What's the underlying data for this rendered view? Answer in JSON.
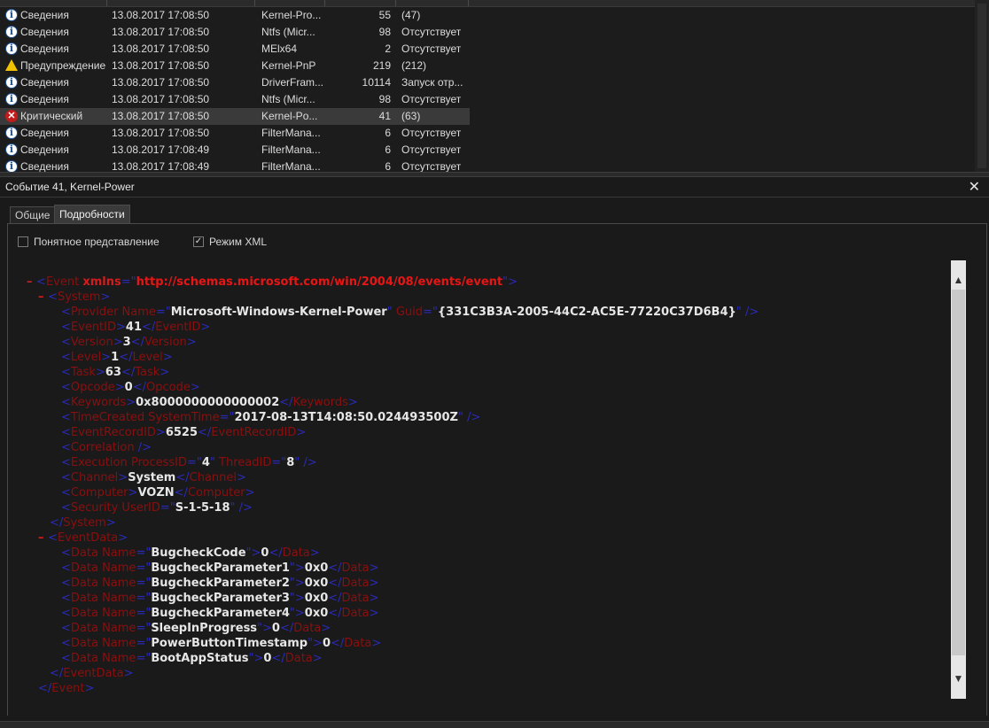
{
  "events": [
    {
      "level": "Сведения",
      "type": "info",
      "date": "13.08.2017 17:08:50",
      "source": "Kernel-Pro...",
      "id": "55",
      "task": "(47)"
    },
    {
      "level": "Сведения",
      "type": "info",
      "date": "13.08.2017 17:08:50",
      "source": "Ntfs (Micr...",
      "id": "98",
      "task": "Отсутствует"
    },
    {
      "level": "Сведения",
      "type": "info",
      "date": "13.08.2017 17:08:50",
      "source": "MElx64",
      "id": "2",
      "task": "Отсутствует"
    },
    {
      "level": "Предупреждение",
      "type": "warning",
      "date": "13.08.2017 17:08:50",
      "source": "Kernel-PnP",
      "id": "219",
      "task": "(212)"
    },
    {
      "level": "Сведения",
      "type": "info",
      "date": "13.08.2017 17:08:50",
      "source": "DriverFram...",
      "id": "10114",
      "task": "Запуск отр..."
    },
    {
      "level": "Сведения",
      "type": "info",
      "date": "13.08.2017 17:08:50",
      "source": "Ntfs (Micr...",
      "id": "98",
      "task": "Отсутствует"
    },
    {
      "level": "Критический",
      "type": "critical",
      "date": "13.08.2017 17:08:50",
      "source": "Kernel-Po...",
      "id": "41",
      "task": "(63)",
      "selected": true
    },
    {
      "level": "Сведения",
      "type": "info",
      "date": "13.08.2017 17:08:50",
      "source": "FilterMana...",
      "id": "6",
      "task": "Отсутствует"
    },
    {
      "level": "Сведения",
      "type": "info",
      "date": "13.08.2017 17:08:49",
      "source": "FilterMana...",
      "id": "6",
      "task": "Отсутствует"
    },
    {
      "level": "Сведения",
      "type": "info",
      "date": "13.08.2017 17:08:49",
      "source": "FilterMana...",
      "id": "6",
      "task": "Отсутствует"
    }
  ],
  "detail": {
    "title": "Событие 41, Kernel-Power",
    "close": "✕",
    "tabs": [
      "Общие",
      "Подробности"
    ],
    "active_tab": 1,
    "view_friendly": "Понятное представление",
    "view_xml": "Режим XML",
    "xml_checked": true
  },
  "xml": {
    "namespace": "http://schemas.microsoft.com/win/2004/08/events/event",
    "provider_name": "Microsoft-Windows-Kernel-Power",
    "provider_guid": "{331C3B3A-2005-44C2-AC5E-77220C37D6B4}",
    "event_id": "41",
    "version": "3",
    "level": "1",
    "task": "63",
    "opcode": "0",
    "keywords": "0x8000000000000002",
    "time_created": "2017-08-13T14:08:50.024493500Z",
    "event_record_id": "6525",
    "process_id": "4",
    "thread_id": "8",
    "channel": "System",
    "computer": "VOZN",
    "user_id": "S-1-5-18",
    "data": [
      {
        "name": "BugcheckCode",
        "value": "0"
      },
      {
        "name": "BugcheckParameter1",
        "value": "0x0"
      },
      {
        "name": "BugcheckParameter2",
        "value": "0x0"
      },
      {
        "name": "BugcheckParameter3",
        "value": "0x0"
      },
      {
        "name": "BugcheckParameter4",
        "value": "0x0"
      },
      {
        "name": "SleepInProgress",
        "value": "0"
      },
      {
        "name": "PowerButtonTimestamp",
        "value": "0"
      },
      {
        "name": "BootAppStatus",
        "value": "0"
      }
    ]
  },
  "colors": {
    "background": "#1a1a1a",
    "selected_row": "#3a3a3a",
    "xml_tag": "#8b0f0f",
    "xml_bracket": "#2a2ab8",
    "xml_value": "#e6e6e6"
  }
}
